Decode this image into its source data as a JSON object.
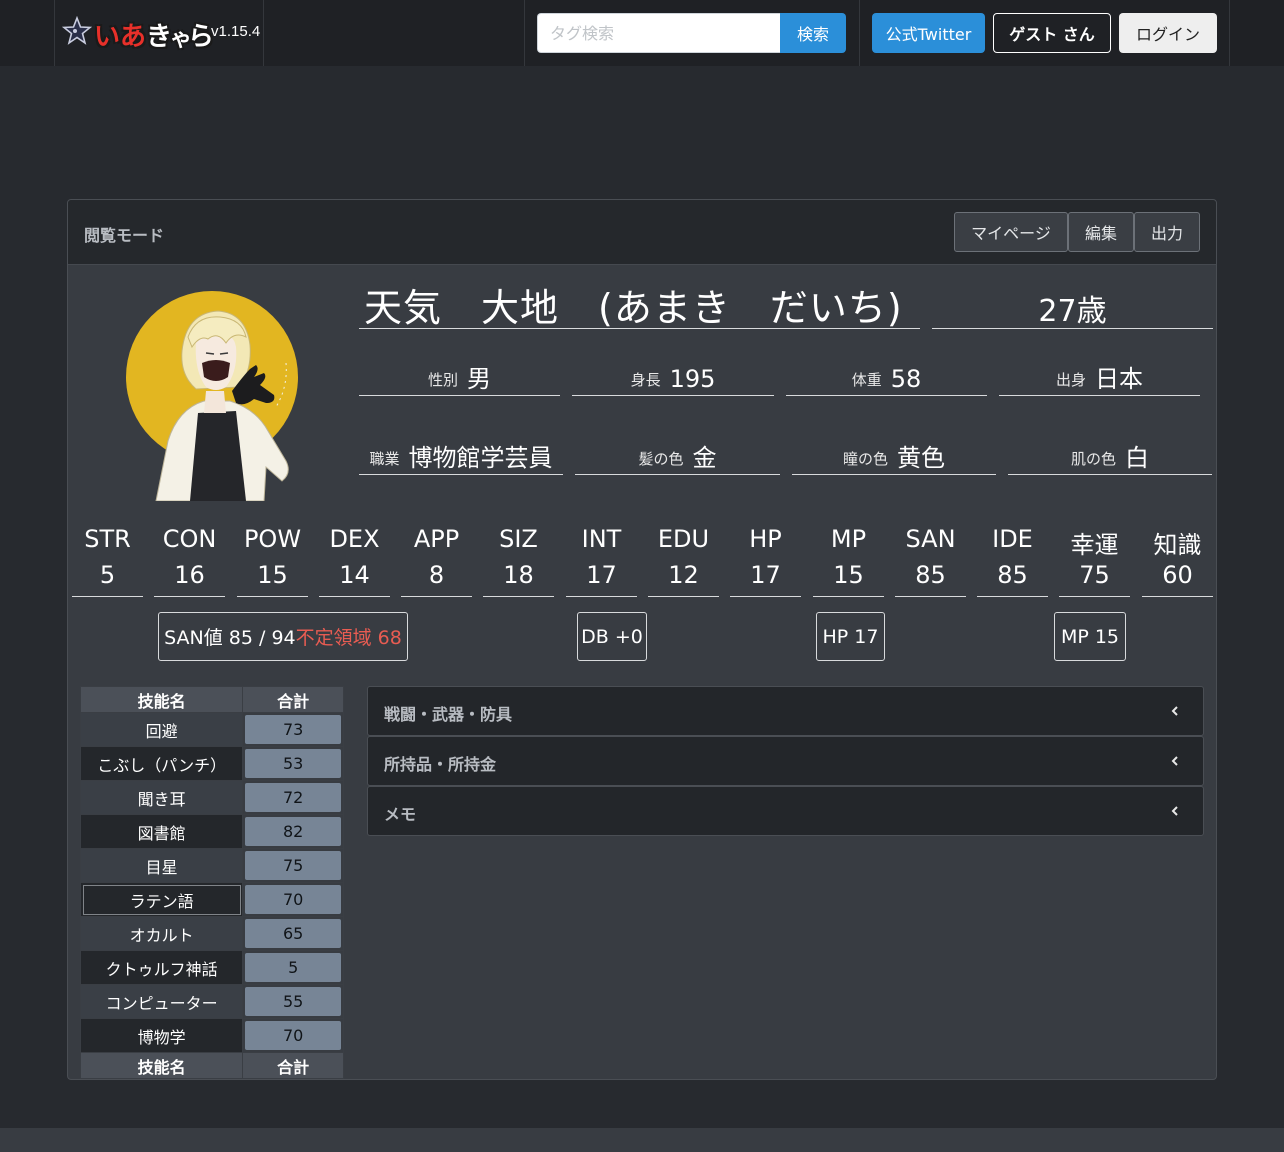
{
  "header": {
    "brand_logo_text": "いあきゃら",
    "version": "v1.15.4",
    "search_placeholder": "タグ検索",
    "search_label": "検索",
    "twitter_label": "公式Twitter",
    "guest_label": "ゲスト さん",
    "login_label": "ログイン"
  },
  "card": {
    "mode_label": "閲覧モード",
    "mypage_label": "マイページ",
    "edit_label": "編集",
    "export_label": "出力"
  },
  "profile": {
    "name": "天気　大地　(あまき　だいち)",
    "age": "27歳",
    "fields": [
      {
        "label": "性別",
        "value": "男"
      },
      {
        "label": "身長",
        "value": "195"
      },
      {
        "label": "体重",
        "value": "58"
      },
      {
        "label": "出身",
        "value": "日本"
      },
      {
        "label": "職業",
        "value": "博物館学芸員"
      },
      {
        "label": "髪の色",
        "value": "金"
      },
      {
        "label": "瞳の色",
        "value": "黄色"
      },
      {
        "label": "肌の色",
        "value": "白"
      }
    ]
  },
  "stats": [
    {
      "label": "STR",
      "value": "5"
    },
    {
      "label": "CON",
      "value": "16"
    },
    {
      "label": "POW",
      "value": "15"
    },
    {
      "label": "DEX",
      "value": "14"
    },
    {
      "label": "APP",
      "value": "8"
    },
    {
      "label": "SIZ",
      "value": "18"
    },
    {
      "label": "INT",
      "value": "17"
    },
    {
      "label": "EDU",
      "value": "12"
    },
    {
      "label": "HP",
      "value": "17"
    },
    {
      "label": "MP",
      "value": "15"
    },
    {
      "label": "SAN",
      "value": "85"
    },
    {
      "label": "IDE",
      "value": "85"
    },
    {
      "label": "幸運",
      "value": "75"
    },
    {
      "label": "知識",
      "value": "60"
    }
  ],
  "badges": {
    "san_text": "SAN値 85 / 94",
    "san_warn": "不定領域 68",
    "db_text": "DB +0",
    "hp_text": "HP 17",
    "mp_text": "MP 15"
  },
  "skills": {
    "header_name": "技能名",
    "header_total": "合計",
    "rows": [
      {
        "name": "回避",
        "total": "73"
      },
      {
        "name": "こぶし（パンチ）",
        "total": "53"
      },
      {
        "name": "聞き耳",
        "total": "72"
      },
      {
        "name": "図書館",
        "total": "82"
      },
      {
        "name": "目星",
        "total": "75"
      },
      {
        "name": "ラテン語",
        "total": "70"
      },
      {
        "name": "オカルト",
        "total": "65"
      },
      {
        "name": "クトゥルフ神話",
        "total": "5"
      },
      {
        "name": "コンピューター",
        "total": "55"
      },
      {
        "name": "博物学",
        "total": "70"
      }
    ]
  },
  "accordion": [
    {
      "title": "戦闘・武器・防具"
    },
    {
      "title": "所持品・所持金"
    },
    {
      "title": "メモ"
    }
  ],
  "colors": {
    "page_bg": "#272a2f",
    "navbar_bg": "#1f2125",
    "card_bg": "#383c42",
    "accent_blue": "#2b8fd9",
    "warn_red": "#e85c52",
    "avatar_circle": "#e2b621"
  }
}
